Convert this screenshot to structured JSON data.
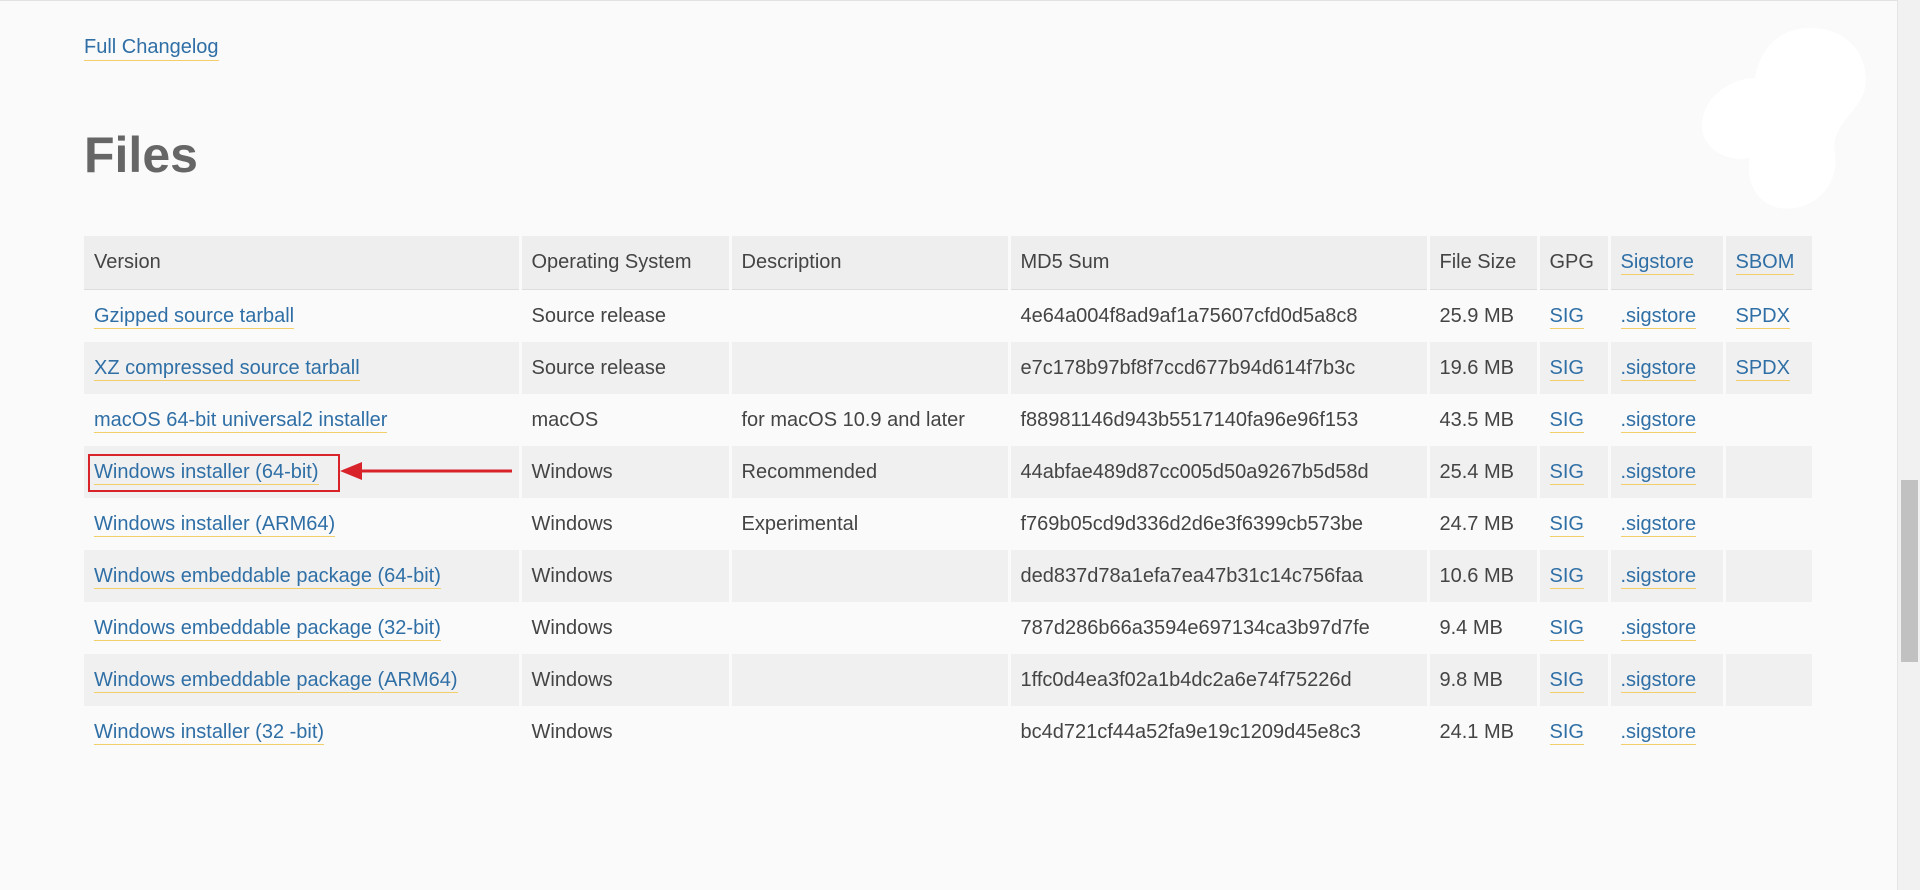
{
  "links": {
    "full_changelog": "Full Changelog"
  },
  "section": {
    "title": "Files"
  },
  "table": {
    "headers": {
      "version": "Version",
      "os": "Operating System",
      "description": "Description",
      "md5": "MD5 Sum",
      "size": "File Size",
      "gpg": "GPG",
      "sigstore": "Sigstore",
      "sbom": "SBOM"
    },
    "rows": [
      {
        "version": "Gzipped source tarball",
        "os": "Source release",
        "description": "",
        "md5": "4e64a004f8ad9af1a75607cfd0d5a8c8",
        "size": "25.9 MB",
        "gpg": "SIG",
        "sigstore": ".sigstore",
        "sbom": "SPDX"
      },
      {
        "version": "XZ compressed source tarball",
        "os": "Source release",
        "description": "",
        "md5": "e7c178b97bf8f7ccd677b94d614f7b3c",
        "size": "19.6 MB",
        "gpg": "SIG",
        "sigstore": ".sigstore",
        "sbom": "SPDX"
      },
      {
        "version": "macOS 64-bit universal2 installer",
        "os": "macOS",
        "description": "for macOS 10.9 and later",
        "md5": "f88981146d943b5517140fa96e96f153",
        "size": "43.5 MB",
        "gpg": "SIG",
        "sigstore": ".sigstore",
        "sbom": ""
      },
      {
        "version": "Windows installer (64-bit)",
        "os": "Windows",
        "description": "Recommended",
        "md5": "44abfae489d87cc005d50a9267b5d58d",
        "size": "25.4 MB",
        "gpg": "SIG",
        "sigstore": ".sigstore",
        "sbom": ""
      },
      {
        "version": "Windows installer (ARM64)",
        "os": "Windows",
        "description": "Experimental",
        "md5": "f769b05cd9d336d2d6e3f6399cb573be",
        "size": "24.7 MB",
        "gpg": "SIG",
        "sigstore": ".sigstore",
        "sbom": ""
      },
      {
        "version": "Windows embeddable package (64-bit)",
        "os": "Windows",
        "description": "",
        "md5": "ded837d78a1efa7ea47b31c14c756faa",
        "size": "10.6 MB",
        "gpg": "SIG",
        "sigstore": ".sigstore",
        "sbom": ""
      },
      {
        "version": "Windows embeddable package (32-bit)",
        "os": "Windows",
        "description": "",
        "md5": "787d286b66a3594e697134ca3b97d7fe",
        "size": "9.4 MB",
        "gpg": "SIG",
        "sigstore": ".sigstore",
        "sbom": ""
      },
      {
        "version": "Windows embeddable package (ARM64)",
        "os": "Windows",
        "description": "",
        "md5": "1ffc0d4ea3f02a1b4dc2a6e74f75226d",
        "size": "9.8 MB",
        "gpg": "SIG",
        "sigstore": ".sigstore",
        "sbom": ""
      },
      {
        "version": "Windows installer (32 -bit)",
        "os": "Windows",
        "description": "",
        "md5": "bc4d721cf44a52fa9e19c1209d45e8c3",
        "size": "24.1 MB",
        "gpg": "SIG",
        "sigstore": ".sigstore",
        "sbom": ""
      }
    ]
  },
  "annotation": {
    "highlight_color": "#d9232b",
    "arrow_icon": "left-arrow-icon"
  },
  "colors": {
    "link": "#2f6fa6",
    "link_underline": "#f2cf6b",
    "header_bg": "#eeeeee",
    "row_alt_bg": "#f0f0f0",
    "page_bg": "#fafafa"
  }
}
